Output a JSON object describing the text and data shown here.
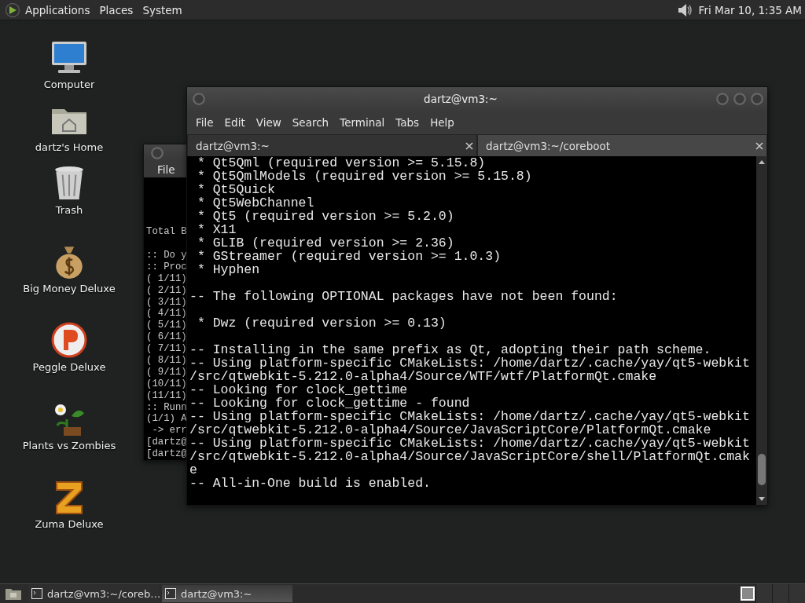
{
  "top_panel": {
    "menus": [
      "Applications",
      "Places",
      "System"
    ],
    "clock": "Fri Mar 10, 1:35 AM"
  },
  "desktop_icons": [
    {
      "kind": "computer",
      "label": "Computer"
    },
    {
      "kind": "home",
      "label": "dartz's Home"
    },
    {
      "kind": "trash",
      "label": "Trash"
    },
    {
      "kind": "moneybag",
      "label": "Big Money Deluxe"
    },
    {
      "kind": "peggle",
      "label": "Peggle Deluxe"
    },
    {
      "kind": "plants",
      "label": "Plants vs Zombies"
    },
    {
      "kind": "zuma",
      "label": "Zuma Deluxe"
    }
  ],
  "back_window": {
    "menu": [
      "File"
    ],
    "blocks": [
      [
        "Total B"
      ],
      [
        ":: Do y",
        ":: Proc",
        "( 1/11)",
        "( 2/11)",
        "( 3/11)",
        "( 4/11)",
        "( 5/11)",
        "( 6/11)",
        "( 7/11)",
        "( 8/11)",
        "( 9/11)",
        "(10/11)",
        "(11/11)",
        ":: Runn",
        "(1/1) A",
        " -> err",
        "[dartz@",
        "[dartz@"
      ]
    ]
  },
  "window": {
    "title": "dartz@vm3:~",
    "menu": [
      "File",
      "Edit",
      "View",
      "Search",
      "Terminal",
      "Tabs",
      "Help"
    ],
    "tabs": [
      {
        "label": "dartz@vm3:~",
        "selected": true
      },
      {
        "label": "dartz@vm3:~/coreboot",
        "selected": false
      }
    ],
    "terminal_blocks": [
      [
        " * Qt5Qml (required version >= 5.15.8)",
        " * Qt5QmlModels (required version >= 5.15.8)",
        " * Qt5Quick",
        " * Qt5WebChannel",
        " * Qt5 (required version >= 5.2.0)",
        " * X11",
        " * GLIB (required version >= 2.36)",
        " * GStreamer (required version >= 1.0.3)",
        " * Hyphen"
      ],
      [
        "-- The following OPTIONAL packages have not been found:"
      ],
      [
        " * Dwz (required version >= 0.13)"
      ],
      [
        "-- Installing in the same prefix as Qt, adopting their path scheme.",
        "-- Using platform-specific CMakeLists: /home/dartz/.cache/yay/qt5-webkit",
        "/src/qtwebkit-5.212.0-alpha4/Source/WTF/wtf/PlatformQt.cmake",
        "-- Looking for clock_gettime",
        "-- Looking for clock_gettime - found",
        "-- Using platform-specific CMakeLists: /home/dartz/.cache/yay/qt5-webkit",
        "/src/qtwebkit-5.212.0-alpha4/Source/JavaScriptCore/PlatformQt.cmake",
        "-- Using platform-specific CMakeLists: /home/dartz/.cache/yay/qt5-webkit",
        "/src/qtwebkit-5.212.0-alpha4/Source/JavaScriptCore/shell/PlatformQt.cmak",
        "e",
        "-- All-in-One build is enabled."
      ]
    ]
  },
  "taskbar": {
    "tasks": [
      {
        "label": "dartz@vm3:~/coreb…",
        "selected": false
      },
      {
        "label": "dartz@vm3:~",
        "selected": true
      }
    ],
    "workspaces": [
      {
        "selected": true
      },
      {
        "selected": false
      },
      {
        "selected": false
      },
      {
        "selected": false
      }
    ]
  }
}
